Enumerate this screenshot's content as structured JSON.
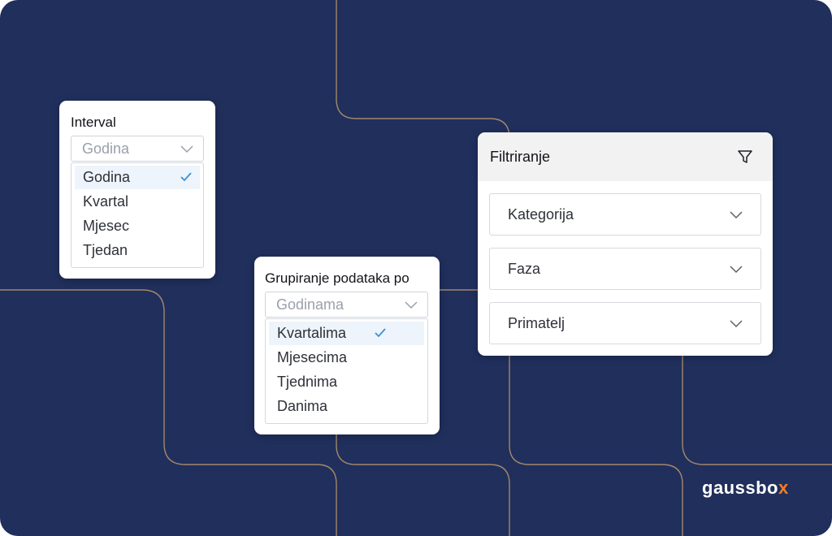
{
  "interval": {
    "label": "Interval",
    "selected_value": "Godina",
    "options": [
      "Godina",
      "Kvartal",
      "Mjesec",
      "Tjedan"
    ],
    "highlighted_option": "Godina"
  },
  "grouping": {
    "label": "Grupiranje podataka po",
    "selected_value": "Godinama",
    "options": [
      "Kvartalima",
      "Mjesecima",
      "Tjednima",
      "Danima"
    ],
    "highlighted_option": "Kvartalima"
  },
  "filter": {
    "title": "Filtriranje",
    "icon": "funnel-icon",
    "fields": [
      "Kategorija",
      "Faza",
      "Primatelj"
    ]
  },
  "brand": {
    "name_main": "gaussbo",
    "name_accent": "x"
  },
  "colors": {
    "background": "#202f5c",
    "lines": "#a4876a",
    "check": "#3b8fd9",
    "brand_accent": "#f47b20"
  }
}
